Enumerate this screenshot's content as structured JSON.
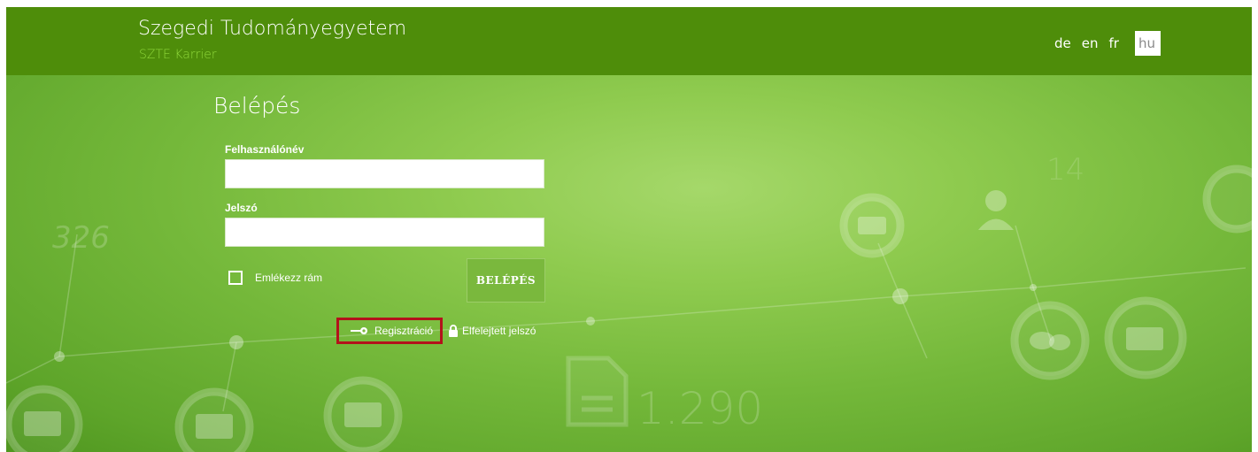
{
  "header": {
    "title": "Szegedi Tudományegyetem",
    "subtitle": "SZTE Karrier",
    "languages": [
      "de",
      "en",
      "fr",
      "hu"
    ],
    "active_language": "hu"
  },
  "login": {
    "title": "Belépés",
    "username_label": "Felhasználónév",
    "username_value": "",
    "password_label": "Jelszó",
    "password_value": "",
    "remember_label": "Emlékezz rám",
    "remember_checked": false,
    "submit_label": "BELÉPÉS"
  },
  "links": {
    "register_label": "Regisztráció",
    "forgot_label": "Elfelejtett jelszó"
  },
  "background": {
    "numbers": [
      "326",
      "14",
      "1.290"
    ]
  },
  "colors": {
    "header_bg": "#4e8d0a",
    "subtitle": "#8fd83a",
    "hero_light": "#a5d86a",
    "hero_dark": "#4f961f",
    "button_bg": "#7ab83d",
    "highlight_border": "#b3121b"
  }
}
